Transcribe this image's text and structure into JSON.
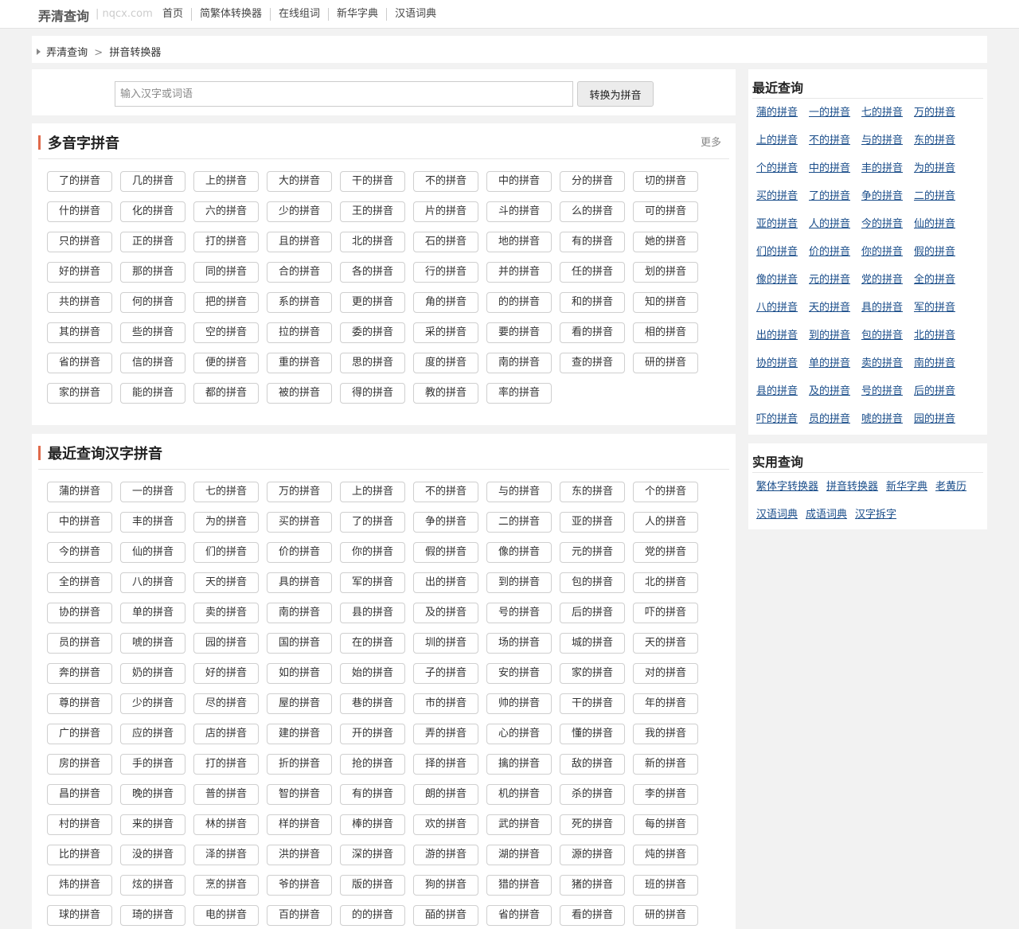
{
  "topbar": {
    "logo": "弄清查询",
    "domain": "| nqcx.com",
    "nav": [
      "首页",
      "简繁体转换器",
      "在线组词",
      "新华字典",
      "汉语词典"
    ]
  },
  "breadcrumb": {
    "home": "弄清查询",
    "sep": ">",
    "current": "拼音转换器"
  },
  "search": {
    "placeholder": "输入汉字或词语",
    "value": "",
    "button": "转换为拼音"
  },
  "polyphonic": {
    "title": "多音字拼音",
    "more": "更多",
    "items": [
      "了的拼音",
      "几的拼音",
      "上的拼音",
      "大的拼音",
      "干的拼音",
      "不的拼音",
      "中的拼音",
      "分的拼音",
      "切的拼音",
      "什的拼音",
      "化的拼音",
      "六的拼音",
      "少的拼音",
      "王的拼音",
      "片的拼音",
      "斗的拼音",
      "么的拼音",
      "可的拼音",
      "只的拼音",
      "正的拼音",
      "打的拼音",
      "且的拼音",
      "北的拼音",
      "石的拼音",
      "地的拼音",
      "有的拼音",
      "她的拼音",
      "好的拼音",
      "那的拼音",
      "同的拼音",
      "合的拼音",
      "各的拼音",
      "行的拼音",
      "并的拼音",
      "任的拼音",
      "划的拼音",
      "共的拼音",
      "何的拼音",
      "把的拼音",
      "系的拼音",
      "更的拼音",
      "角的拼音",
      "的的拼音",
      "和的拼音",
      "知的拼音",
      "其的拼音",
      "些的拼音",
      "空的拼音",
      "拉的拼音",
      "委的拼音",
      "采的拼音",
      "要的拼音",
      "看的拼音",
      "相的拼音",
      "省的拼音",
      "信的拼音",
      "便的拼音",
      "重的拼音",
      "思的拼音",
      "度的拼音",
      "南的拼音",
      "查的拼音",
      "研的拼音",
      "家的拼音",
      "能的拼音",
      "都的拼音",
      "被的拼音",
      "得的拼音",
      "教的拼音",
      "率的拼音"
    ]
  },
  "recent_hanzi": {
    "title": "最近查询汉字拼音",
    "items": [
      "蒲的拼音",
      "一的拼音",
      "七的拼音",
      "万的拼音",
      "上的拼音",
      "不的拼音",
      "与的拼音",
      "东的拼音",
      "个的拼音",
      "中的拼音",
      "丰的拼音",
      "为的拼音",
      "买的拼音",
      "了的拼音",
      "争的拼音",
      "二的拼音",
      "亚的拼音",
      "人的拼音",
      "今的拼音",
      "仙的拼音",
      "们的拼音",
      "价的拼音",
      "你的拼音",
      "假的拼音",
      "像的拼音",
      "元的拼音",
      "党的拼音",
      "全的拼音",
      "八的拼音",
      "天的拼音",
      "具的拼音",
      "军的拼音",
      "出的拼音",
      "到的拼音",
      "包的拼音",
      "北的拼音",
      "协的拼音",
      "单的拼音",
      "卖的拼音",
      "南的拼音",
      "县的拼音",
      "及的拼音",
      "号的拼音",
      "后的拼音",
      "吓的拼音",
      "员的拼音",
      "唬的拼音",
      "园的拼音",
      "国的拼音",
      "在的拼音",
      "圳的拼音",
      "场的拼音",
      "城的拼音",
      "天的拼音",
      "奔的拼音",
      "奶的拼音",
      "好的拼音",
      "如的拼音",
      "始的拼音",
      "子的拼音",
      "安的拼音",
      "家的拼音",
      "对的拼音",
      "尊的拼音",
      "少的拼音",
      "尽的拼音",
      "屋的拼音",
      "巷的拼音",
      "市的拼音",
      "帅的拼音",
      "干的拼音",
      "年的拼音",
      "广的拼音",
      "应的拼音",
      "店的拼音",
      "建的拼音",
      "开的拼音",
      "弄的拼音",
      "心的拼音",
      "懂的拼音",
      "我的拼音",
      "房的拼音",
      "手的拼音",
      "打的拼音",
      "折的拼音",
      "抢的拼音",
      "择的拼音",
      "擒的拼音",
      "敌的拼音",
      "新的拼音",
      "昌的拼音",
      "晚的拼音",
      "普的拼音",
      "智的拼音",
      "有的拼音",
      "朗的拼音",
      "机的拼音",
      "杀的拼音",
      "李的拼音",
      "村的拼音",
      "来的拼音",
      "林的拼音",
      "样的拼音",
      "棒的拼音",
      "欢的拼音",
      "武的拼音",
      "死的拼音",
      "每的拼音",
      "比的拼音",
      "没的拼音",
      "泽的拼音",
      "洪的拼音",
      "深的拼音",
      "游的拼音",
      "湖的拼音",
      "源的拼音",
      "炖的拼音",
      "炜的拼音",
      "炫的拼音",
      "烹的拼音",
      "爷的拼音",
      "版的拼音",
      "狗的拼音",
      "猎的拼音",
      "猪的拼音",
      "班的拼音",
      "球的拼音",
      "琦的拼音",
      "电的拼音",
      "百的拼音",
      "的的拼音",
      "皕的拼音",
      "省的拼音",
      "看的拼音",
      "研的拼音"
    ]
  },
  "sidebar_recent": {
    "title": "最近查询",
    "items": [
      "蒲的拼音",
      "一的拼音",
      "七的拼音",
      "万的拼音",
      "上的拼音",
      "不的拼音",
      "与的拼音",
      "东的拼音",
      "个的拼音",
      "中的拼音",
      "丰的拼音",
      "为的拼音",
      "买的拼音",
      "了的拼音",
      "争的拼音",
      "二的拼音",
      "亚的拼音",
      "人的拼音",
      "今的拼音",
      "仙的拼音",
      "们的拼音",
      "价的拼音",
      "你的拼音",
      "假的拼音",
      "像的拼音",
      "元的拼音",
      "党的拼音",
      "全的拼音",
      "八的拼音",
      "天的拼音",
      "具的拼音",
      "军的拼音",
      "出的拼音",
      "到的拼音",
      "包的拼音",
      "北的拼音",
      "协的拼音",
      "单的拼音",
      "卖的拼音",
      "南的拼音",
      "县的拼音",
      "及的拼音",
      "号的拼音",
      "后的拼音",
      "吓的拼音",
      "员的拼音",
      "唬的拼音",
      "园的拼音"
    ]
  },
  "sidebar_tools": {
    "title": "实用查询",
    "items": [
      "繁体字转换器",
      "拼音转换器",
      "新华字典",
      "老黄历",
      "汉语词典",
      "成语词典",
      "汉字拆字"
    ]
  }
}
